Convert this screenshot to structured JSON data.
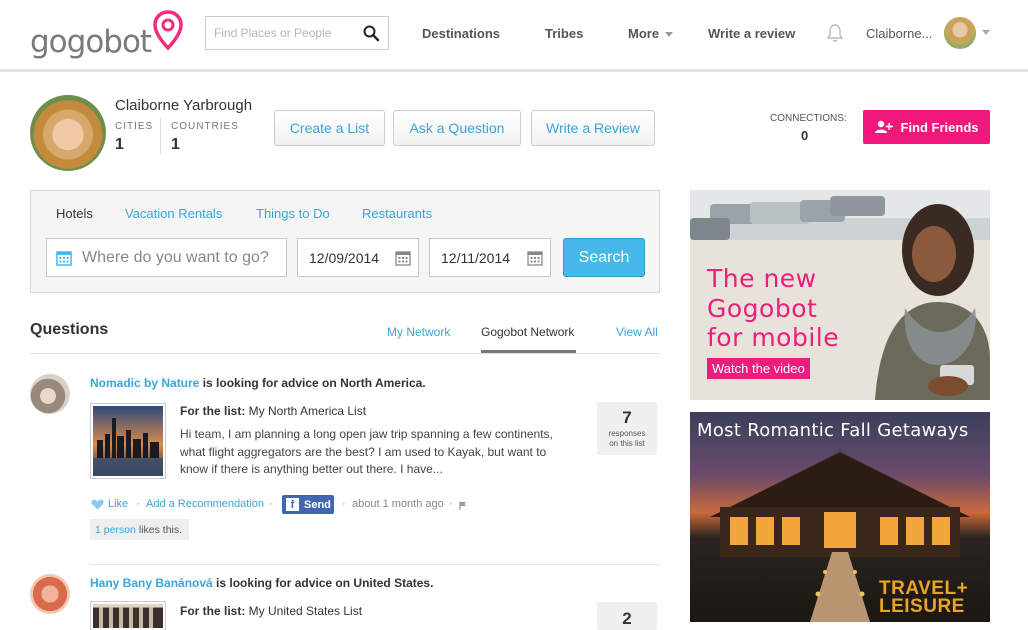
{
  "header": {
    "logo_text": "gogobot",
    "search_placeholder": "Find Places or People",
    "nav": {
      "destinations": "Destinations",
      "tribes": "Tribes",
      "more": "More",
      "write_review": "Write a review"
    },
    "user_name": "Claiborne...",
    "brand_color": "#f0187a"
  },
  "profile": {
    "name": "Claiborne Yarbrough",
    "cities_label": "CITIES",
    "cities_value": "1",
    "countries_label": "COUNTRIES",
    "countries_value": "1",
    "buttons": {
      "create_list": "Create a List",
      "ask_question": "Ask a Question",
      "write_review": "Write a Review"
    },
    "connections_label": "CONNECTIONS:",
    "connections_value": "0",
    "find_friends": "Find Friends"
  },
  "booking": {
    "tabs": [
      "Hotels",
      "Vacation Rentals",
      "Things to Do",
      "Restaurants"
    ],
    "destination_placeholder": "Where do you want to go?",
    "checkin": "12/09/2014",
    "checkout": "12/11/2014",
    "search_label": "Search"
  },
  "questions": {
    "title": "Questions",
    "tabs": {
      "my_network": "My Network",
      "gogobot_network": "Gogobot Network",
      "view_all": "View All"
    },
    "items": [
      {
        "user": "Nomadic by Nature",
        "phrase": " is looking for advice on ",
        "place": "North America.",
        "list_label": "For the list:",
        "list_name": " My North America List",
        "body": "Hi team, I am planning a long open jaw trip spanning a few continents, what flight aggregators are the best? I am used to Kayak, but want to know if there is anything better out there. I have...",
        "responses": "7",
        "responses_label_1": "responses",
        "responses_label_2": "on this list",
        "like": "Like",
        "add_recommendation": "Add a Recommendation",
        "send": "Send",
        "time": "about 1 month ago",
        "likes_link": "1 person",
        "likes_text": "likes this."
      },
      {
        "user": "Hany Bany Banánová",
        "phrase": " is looking for advice on ",
        "place": "United States.",
        "list_label": "For the list:",
        "list_name": " My United States List",
        "responses": "2"
      }
    ]
  },
  "ads": {
    "mobile_line1": "The new",
    "mobile_line2": "Gogobot",
    "mobile_line3": "for mobile",
    "mobile_cta": "Watch the video",
    "romantic_title": "Most Romantic Fall Getaways",
    "brand_line1": "TRAVEL+",
    "brand_line2": "LEISURE"
  }
}
